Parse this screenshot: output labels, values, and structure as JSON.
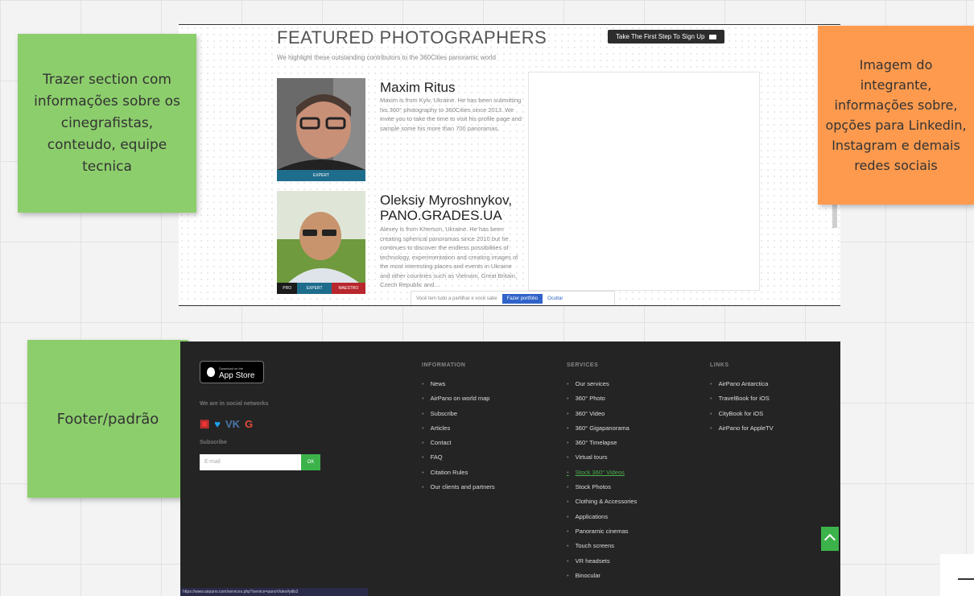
{
  "site": {
    "title": "FEATURED PHOTOGRAPHERS",
    "subtitle": "We highlight these outstanding contributors to the 360Cities panoramic world",
    "signup_label": "Take The First Step To Sign Up",
    "photographers": [
      {
        "name": "Maxim Ritus",
        "bio": "Maxim is from Kyiv, Ukraine. He has been submitting his 360° photography to 360Cities since 2013. We invite you to take the time to visit his profile page and sample some his more than 700 panoramas.",
        "badges": [
          "EXPERT"
        ]
      },
      {
        "name": "Oleksiy Myroshnykov, PANO.GRADES.UA",
        "bio": "Alexey is from Kherson, Ukraine. He has been creating spherical panoramas since 2010 but he continues to discover the endless possibilities of technology, experimentation and creating images of the most interesting places and events in Ukraine and other countries such as Vietnam, Great Britain, Czech Republic and...",
        "badges": [
          "PRO",
          "EXPERT",
          "MAESTRO"
        ]
      }
    ],
    "cookie": {
      "text": "Você tem tudo a partilhar e você sabe",
      "accept": "Fazer portfólio",
      "reject": "Ocultar"
    }
  },
  "notes": {
    "section": "Trazer section com informações sobre os cinegrafistas, conteudo, equipe tecnica",
    "member": "Imagem do integrante, informações sobre, opções para Linkedin, Instagram e demais redes sociais",
    "footer": "Footer/padrão"
  },
  "footer": {
    "appstore_small": "Download on the",
    "appstore_big": "App Store",
    "social_label": "We are in social networks",
    "subscribe_label": "Subscribe",
    "email_placeholder": "E-mail",
    "ok_label": "OK",
    "columns": {
      "information": {
        "title": "INFORMATION",
        "items": [
          "News",
          "AirPano on world map",
          "Subscribe",
          "Articles",
          "Contact",
          "FAQ",
          "Citation Rules",
          "Our clients and partners"
        ]
      },
      "services": {
        "title": "SERVICES",
        "items": [
          "Our services",
          "360° Photo",
          "360° Video",
          "360° Gigapanorama",
          "360° Timelapse",
          "Virtual tours",
          "Stock 360° Videos",
          "Stock Photos",
          "Clothing & Accessories",
          "Applications",
          "Panoramic cinemas",
          "Touch screens",
          "VR headsets",
          "Binocular"
        ]
      },
      "links": {
        "title": "LINKS",
        "items": [
          "AirPano Antarctica",
          "TravelBook for iOS",
          "CityBook for iOS",
          "AirPano for AppleTV"
        ]
      }
    },
    "status_url": "https://www.airpano.com/services.php?service=panoVideo#pills2"
  },
  "colors": {
    "note_green": "#8cce6c",
    "note_orange": "#fd9a4e",
    "footer_bg": "#242424",
    "accent_green": "#3cb34a",
    "badge_blue": "#1f6d8c",
    "badge_red": "#b8272d"
  }
}
